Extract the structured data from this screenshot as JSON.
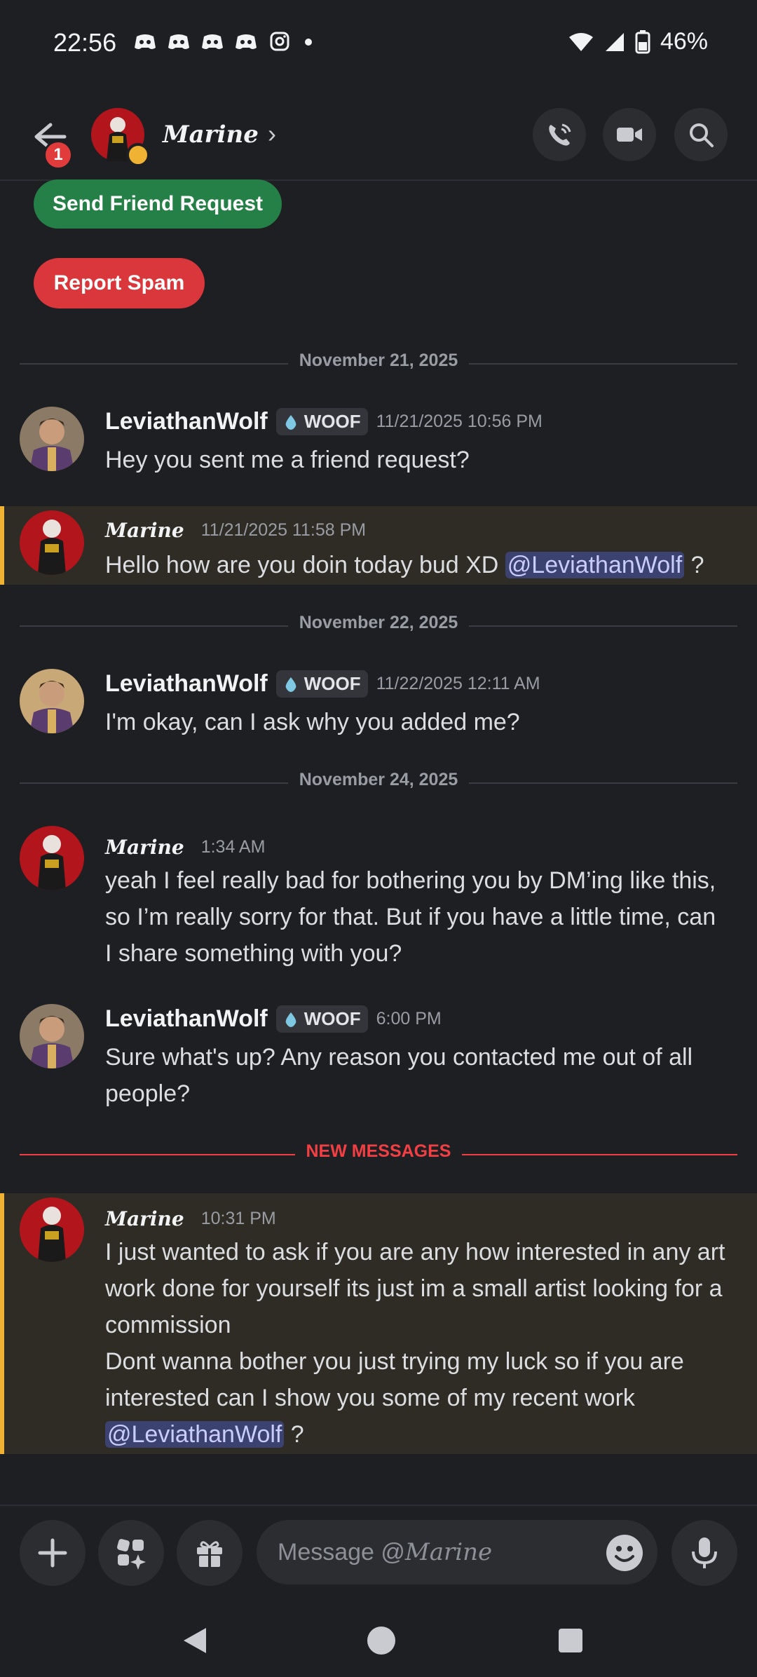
{
  "status_bar": {
    "time": "22:56",
    "battery": "46%"
  },
  "header": {
    "back_badge": "1",
    "name": "Marine",
    "chevron": "›"
  },
  "actions": {
    "friend_request": "Send Friend Request",
    "report_spam": "Report Spam"
  },
  "dividers": {
    "d1": "November 21, 2025",
    "d2": "November 22, 2025",
    "d3": "November 24, 2025",
    "new": "NEW MESSAGES"
  },
  "colors": {
    "accent_green": "#248046",
    "accent_red": "#da373c",
    "highlight_bar": "#f0b232",
    "new_messages": "#f23f43"
  },
  "messages": [
    {
      "author": "LeviathanWolf",
      "tag": "WOOF",
      "time": "11/21/2025 10:56 PM",
      "text": "Hey you sent me a friend request?"
    },
    {
      "author": "Marine",
      "time": "11/21/2025 11:58 PM",
      "text": "Hello how are you doin today bud XD ",
      "mention": "@LeviathanWolf",
      "after": " ?"
    },
    {
      "author": "LeviathanWolf",
      "tag": "WOOF",
      "time": "11/22/2025 12:11 AM",
      "text": "I'm okay, can I ask why you added me?"
    },
    {
      "author": "Marine",
      "time": "1:34 AM",
      "text": "yeah I feel really bad for bothering you by DM’ing like this, so I’m really sorry for that. But if you have a little time, can I share something with you?"
    },
    {
      "author": "LeviathanWolf",
      "tag": "WOOF",
      "time": "6:00 PM",
      "text": "Sure what's up? Any reason you contacted me out of all people?"
    },
    {
      "author": "Marine",
      "time": "10:31 PM",
      "line1": "I just wanted to ask if you are any how interested in any art work done for yourself its just im a small artist looking for a commission",
      "line2": "Dont wanna bother you just trying my luck so if you are interested can I show you some of my recent work",
      "mention": "@LeviathanWolf",
      "after": " ?"
    }
  ],
  "composer": {
    "placeholder_prefix": "Message @",
    "placeholder_name": "Marine"
  }
}
